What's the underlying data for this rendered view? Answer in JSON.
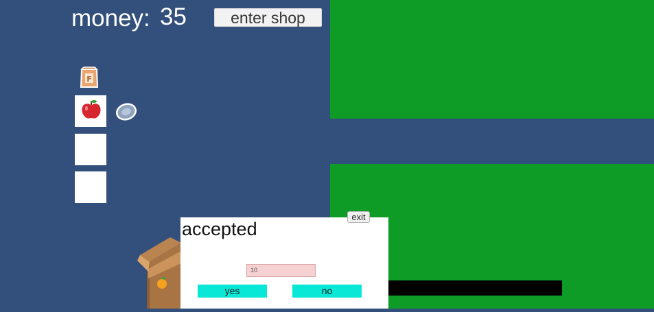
{
  "hud": {
    "money_label": "money:",
    "money_value": "35",
    "shop_button": "enter shop"
  },
  "inventory": {
    "items": [
      {
        "icon": "flour-bag-icon",
        "letter": "F"
      },
      {
        "icon": "apple-icon"
      },
      {
        "icon": "coin-icon"
      }
    ],
    "empty_slots": 2
  },
  "dialog": {
    "title": "accepted",
    "exit_label": "exit",
    "offer_value": "10",
    "yes_label": "yes",
    "no_label": "no"
  },
  "colors": {
    "background": "#334f7b",
    "field": "#0f9c26",
    "button_accent": "#09e8d6",
    "input_bg": "#f6d1d1"
  }
}
